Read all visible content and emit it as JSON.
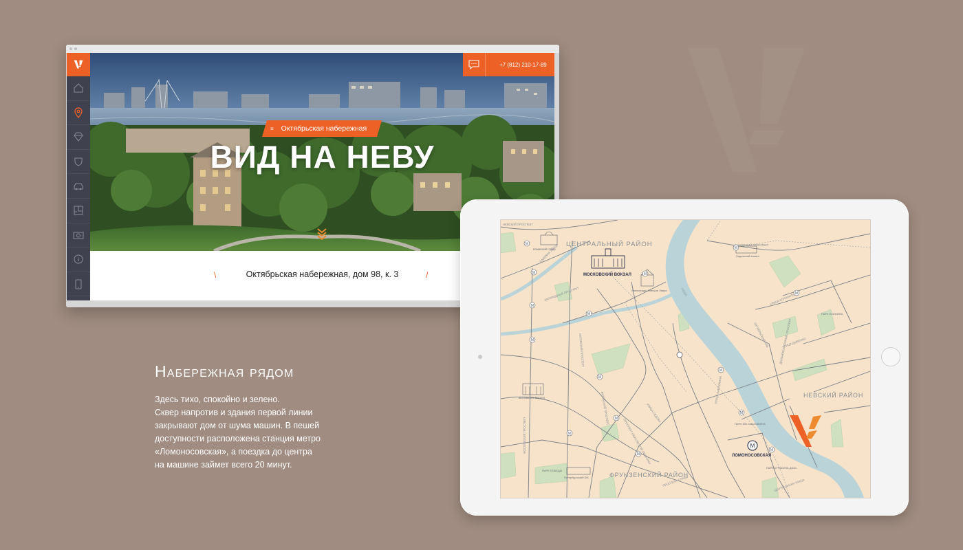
{
  "site": {
    "phone": "+7 (812) 210-17-89",
    "tag": "Октябрьская набережная",
    "hero_title": "ВИД НА НЕВУ",
    "address": "Октябрьская набережная, дом 98, к. 3",
    "address_deco": "\\",
    "address_deco_right": "/",
    "tag_icon": "≡",
    "logo_letter": "V",
    "sidebar_icons": [
      "home-icon",
      "location-pin-icon",
      "diamond-icon",
      "shield-icon",
      "car-icon",
      "floorplan-icon",
      "camera-icon",
      "info-icon",
      "mobile-icon"
    ]
  },
  "section": {
    "title": "Набережная рядом",
    "lines": [
      "Здесь тихо, спокойно и зелено.",
      "Сквер напротив и здания первой линии",
      "закрывают дом от шума машин. В пешей",
      "доступности расположена станция метро",
      "«Ломоносовская», а поездка до центра",
      "на машине займет всего 20 минут."
    ]
  },
  "map": {
    "districts": [
      "ЦЕНТРАЛЬНЫЙ РАЙОН",
      "НЕВСКИЙ РАЙОН",
      "ФРУНЗЕНСКИЙ РАЙОН"
    ],
    "landmarks": {
      "kazan": "Казанский собор",
      "moskovsky_vokzal": "МОСКОВСКИЙ ВОКЗАЛ",
      "lavra": "Александро-Невская Лавра",
      "ladozhsky": "Ладожский вокзал",
      "vorota": "Московские Ворота",
      "lomonosovskaya": "ЛОМОНОСОВСКАЯ",
      "park_esenina": "ПАРК ЕСЕНИНА",
      "park_babushkina": "ПАРК ИМ. БАБУШКИНА",
      "park_kurakina": "ПАРК КУРАКИНА ДАЧА",
      "park_pobedy": "ПАРК ПОБЕДЫ",
      "sport": "Петербургский СКК"
    },
    "streets": {
      "nevsky": "НЕВСКИЙ ПРОСПЕКТ",
      "zagorodny": "ЗАГОРОДНЫЙ ПРОСПЕКТ",
      "sadovaya": "САДОВАЯ УЛИЦА",
      "moskovsky": "МОСКОВСКИЙ ПРОСПЕКТ",
      "ligovsky": "ЛИГОВСКИЙ ПРОСПЕКТ",
      "vitebsky": "ВИТЕБСКИЙ ПРОСПЕКТ",
      "zanevsky": "ЗАНЕВСКИЙ ПРОСПЕКТ",
      "oktyabrskaya": "ОКТЯБРЬСКАЯ НАБ.",
      "kollontai": "УЛИЦА КОЛЛОНТАЙ",
      "dybenko": "УЛИЦА ДЫБЕНКО",
      "dalnevostochny": "ДАЛЬНЕВОСТОЧНЫЙ ПРОСПЕКТ",
      "obukhovskoy": "ПРОСПЕКТ ОБУХОВСКОЙ ОБОРОНЫ",
      "sedova": "УЛИЦА СЕДОВА",
      "slavy": "ПРОСПЕКТ СЛАВЫ",
      "babushkina": "УЛИЦА БАБУШКИНА",
      "reka": "НЕВА",
      "kupchinskaya": "ЦЕНТРАЛЬНАЯ УЛИЦА"
    },
    "metro_letter": "М",
    "colors": {
      "water": "#bad3d8",
      "land": "#f7e3ca",
      "park": "#cfe0bf",
      "accent": "#ee6126"
    }
  }
}
